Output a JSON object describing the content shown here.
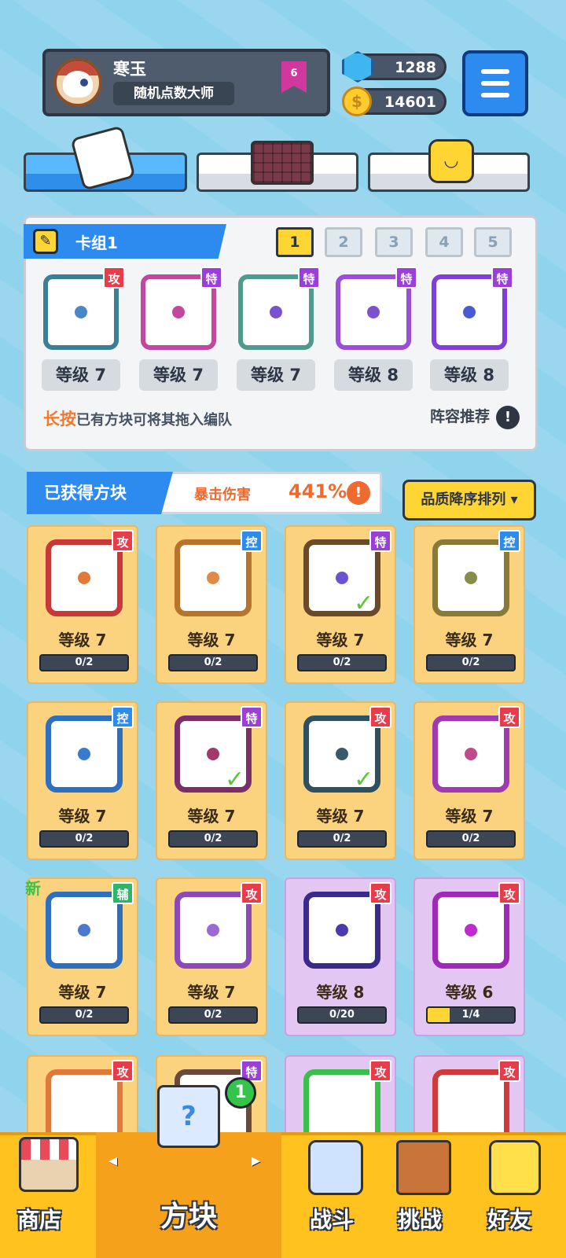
{
  "profile": {
    "name": "寒玉",
    "title": "随机点数大师",
    "rank": "6"
  },
  "currency": {
    "gems": "1288",
    "coins": "14601"
  },
  "deck": {
    "title": "卡组1",
    "slots": [
      "1",
      "2",
      "3",
      "4",
      "5"
    ],
    "active_slot": "1",
    "cards": [
      {
        "level": "等级 7",
        "type": "攻",
        "color": "#3b7f96",
        "dot": "#4a87c9"
      },
      {
        "level": "等级 7",
        "type": "特",
        "color": "#c2489d",
        "dot": "#c2489d"
      },
      {
        "level": "等级 7",
        "type": "特",
        "color": "#4f9a8f",
        "dot": "#7a52d0"
      },
      {
        "level": "等级 8",
        "type": "特",
        "color": "#9a4fd8",
        "dot": "#7a52d0"
      },
      {
        "level": "等级 8",
        "type": "特",
        "color": "#7f3fd8",
        "dot": "#4a5ad0"
      }
    ],
    "hint_strong": "长按",
    "hint_rest": "已有方块可将其拖入编队",
    "recommend": "阵容推荐",
    "recommend_icon": "!"
  },
  "owned": {
    "title": "已获得方块",
    "crit_label": "暴击伤害",
    "crit_value": "441%",
    "crit_icon": "!",
    "sort_label": "品质降序排列 ▾"
  },
  "grid": [
    {
      "level": "等级 7",
      "progress": "0/2",
      "fill": 0,
      "type": "攻",
      "style": "orange",
      "frame": "#c83838",
      "dot": "#e07a3a",
      "check": false,
      "new": false
    },
    {
      "level": "等级 7",
      "progress": "0/2",
      "fill": 0,
      "type": "控",
      "style": "orange",
      "frame": "#b8742a",
      "dot": "#e08a4a",
      "check": false,
      "new": false
    },
    {
      "level": "等级 7",
      "progress": "0/2",
      "fill": 0,
      "type": "特",
      "style": "orange",
      "frame": "#6b4a2a",
      "dot": "#6a52d0",
      "check": true,
      "new": false
    },
    {
      "level": "等级 7",
      "progress": "0/2",
      "fill": 0,
      "type": "控",
      "style": "orange",
      "frame": "#8a7a3a",
      "dot": "#8a8a4a",
      "check": false,
      "new": false
    },
    {
      "level": "等级 7",
      "progress": "0/2",
      "fill": 0,
      "type": "控",
      "style": "orange",
      "frame": "#2f6fc0",
      "dot": "#3a7ad0",
      "check": false,
      "new": false
    },
    {
      "level": "等级 7",
      "progress": "0/2",
      "fill": 0,
      "type": "特",
      "style": "orange",
      "frame": "#7a2f6a",
      "dot": "#a03a6a",
      "check": true,
      "new": false
    },
    {
      "level": "等级 7",
      "progress": "0/2",
      "fill": 0,
      "type": "攻",
      "style": "orange",
      "frame": "#2f5060",
      "dot": "#3a5a6a",
      "check": true,
      "new": false
    },
    {
      "level": "等级 7",
      "progress": "0/2",
      "fill": 0,
      "type": "攻",
      "style": "orange",
      "frame": "#a03ab0",
      "dot": "#c04a8a",
      "check": false,
      "new": false
    },
    {
      "level": "等级 7",
      "progress": "0/2",
      "fill": 0,
      "type": "辅",
      "style": "orange",
      "frame": "#2f6fc0",
      "dot": "#4a7ad0",
      "check": false,
      "new": true
    },
    {
      "level": "等级 7",
      "progress": "0/2",
      "fill": 0,
      "type": "攻",
      "style": "orange",
      "frame": "#8a4ab8",
      "dot": "#9a6ad0",
      "check": false,
      "new": false
    },
    {
      "level": "等级 8",
      "progress": "0/20",
      "fill": 0,
      "type": "攻",
      "style": "purple",
      "frame": "#3a2a8a",
      "dot": "#4a3ab0",
      "check": false,
      "new": false
    },
    {
      "level": "等级 6",
      "progress": "1/4",
      "fill": 0.25,
      "type": "攻",
      "style": "purple",
      "frame": "#a02ab8",
      "dot": "#c02ad0",
      "check": false,
      "new": false
    }
  ],
  "peek_row": [
    {
      "type": "攻",
      "frame": "#e07a3a"
    },
    {
      "type": "特",
      "frame": "#6a4a3a"
    },
    {
      "type": "攻",
      "frame": "#3ac04a"
    },
    {
      "type": "攻",
      "frame": "#d03a3a"
    }
  ],
  "new_label": "新",
  "nav": {
    "shop": "商店",
    "blocks": "方块",
    "battle": "战斗",
    "challenge": "挑战",
    "friends": "好友",
    "blocks_badge": "1",
    "arrow_left": "◂",
    "arrow_right": "▸"
  }
}
